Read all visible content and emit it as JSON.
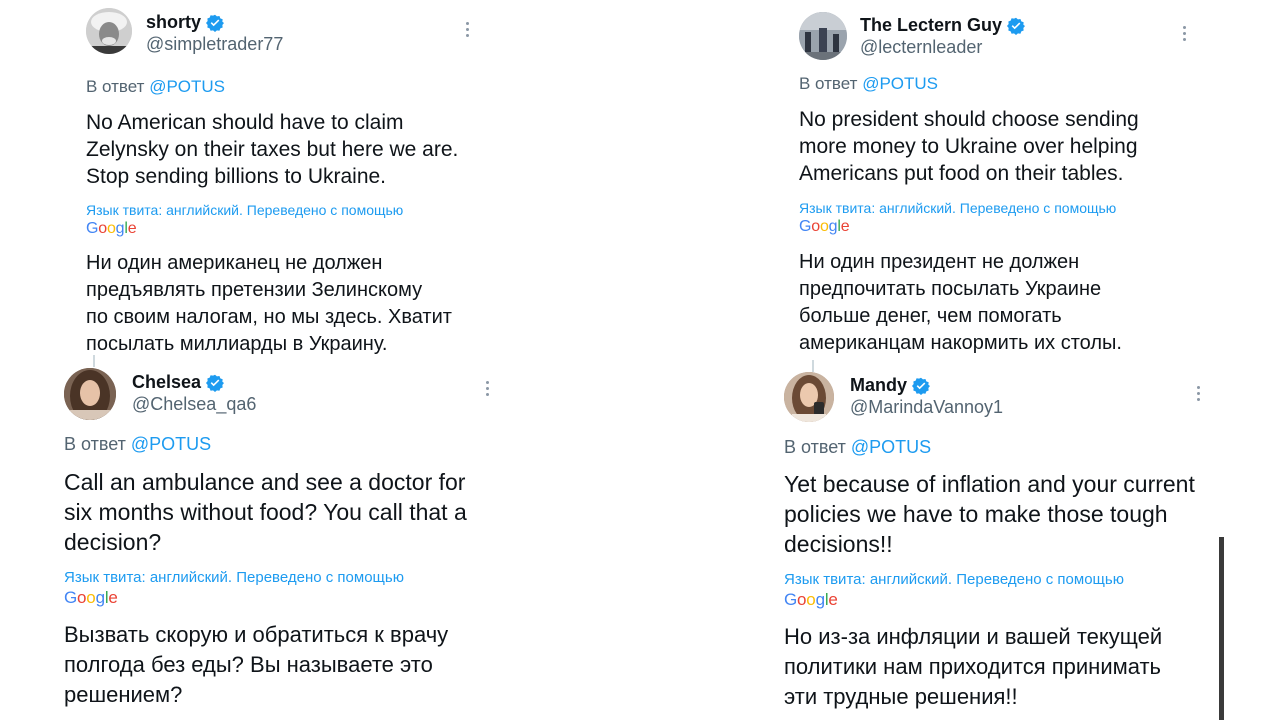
{
  "tweets": [
    {
      "name": "shorty",
      "handle": "@simpletrader77",
      "reply_prefix": "В ответ",
      "reply_to": "@POTUS",
      "text_en": "No American should have to claim\nZelynsky on their taxes but here we are.\nStop sending billions to Ukraine.",
      "translation_note": "Язык твита: английский. Переведено с помощью",
      "text_ru": "Ни один американец не должен\nпредъявлять претензии Зелинскому\nпо своим налогам, но мы здесь. Хватит\nпосылать миллиарды в Украину."
    },
    {
      "name": "The Lectern Guy",
      "handle": "@lecternleader",
      "reply_prefix": "В ответ",
      "reply_to": "@POTUS",
      "text_en": "No president should choose sending\nmore money to Ukraine over helping\nAmericans put food on their tables.",
      "translation_note": "Язык твита: английский. Переведено с помощью",
      "text_ru": "Ни один президент не должен\nпредпочитать посылать Украине\nбольше денег, чем помогать\nамериканцам накормить их столы."
    },
    {
      "name": "Chelsea",
      "handle": "@Chelsea_qa6",
      "reply_prefix": "В ответ",
      "reply_to": "@POTUS",
      "text_en": "Call an ambulance and see a doctor for\nsix months without food? You call that a\ndecision?",
      "translation_note": "Язык твита: английский. Переведено с помощью",
      "text_ru": "Вызвать скорую и обратиться к врачу\nполгода без еды? Вы называете это\nрешением?"
    },
    {
      "name": "Mandy",
      "handle": "@MarindaVannoy1",
      "reply_prefix": "В ответ",
      "reply_to": "@POTUS",
      "text_en": "Yet because of inflation and your current\npolicies we have to make those tough\ndecisions!!",
      "translation_note": "Язык твита: английский. Переведено с помощью",
      "text_ru": "Но из-за инфляции и вашей текущей\nполитики нам приходится принимать\nэти трудные решения!!"
    }
  ],
  "google_logo": "Google",
  "icons": {
    "verified": "verified-badge-icon",
    "more": "more-options-icon"
  },
  "colors": {
    "link": "#1d9bf0",
    "text": "#0f1419",
    "secondary": "#536471"
  }
}
